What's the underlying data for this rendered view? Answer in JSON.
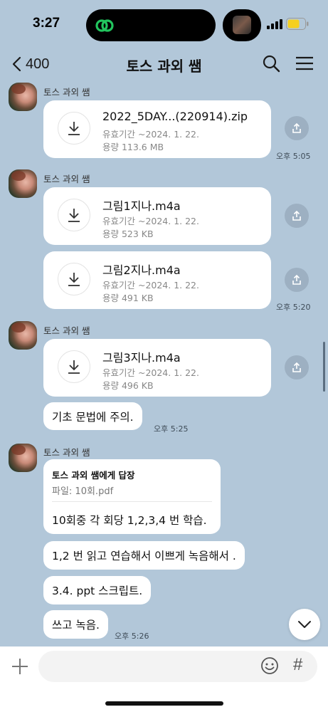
{
  "status": {
    "time": "3:27"
  },
  "nav": {
    "back_count": "400",
    "title": "토스 과외 쌤"
  },
  "groups": [
    {
      "sender": "토스 과외 쌤"
    },
    {
      "sender": "토스 과외 쌤"
    },
    {
      "sender": "토스 과외 쌤"
    },
    {
      "sender": "토스 과외 쌤"
    }
  ],
  "files": [
    {
      "name": "2022_5DAY...(220914).zip",
      "expiry": "유효기간 ~2024. 1. 22.",
      "size": "용량  113.6 MB"
    },
    {
      "name": "그림1지나.m4a",
      "expiry": "유효기간 ~2024. 1. 22.",
      "size": "용량  523 KB"
    },
    {
      "name": "그림2지나.m4a",
      "expiry": "유효기간 ~2024. 1. 22.",
      "size": "용량  491 KB"
    },
    {
      "name": "그림3지나.m4a",
      "expiry": "유효기간 ~2024. 1. 22.",
      "size": "용량  496 KB"
    }
  ],
  "times": [
    "오후 5:05",
    "오후 5:20",
    "오후 5:25",
    "오후 5:26"
  ],
  "messages": [
    "기초 문법에 주의.",
    "1,2 번 읽고 연습해서 이쁘게 녹음해서 .",
    "3.4. ppt 스크립트.",
    "쓰고 녹음."
  ],
  "reply": {
    "header": "토스 과외 쌤에게 답장",
    "quoted": "파일: 10회.pdf",
    "text": "10회중 각 회당 1,2,3,4 번 학습."
  },
  "colors": {
    "background": "#b2c7d9",
    "bubble": "#ffffff",
    "island_icon": "#22c55e",
    "battery": "#f5d020"
  }
}
